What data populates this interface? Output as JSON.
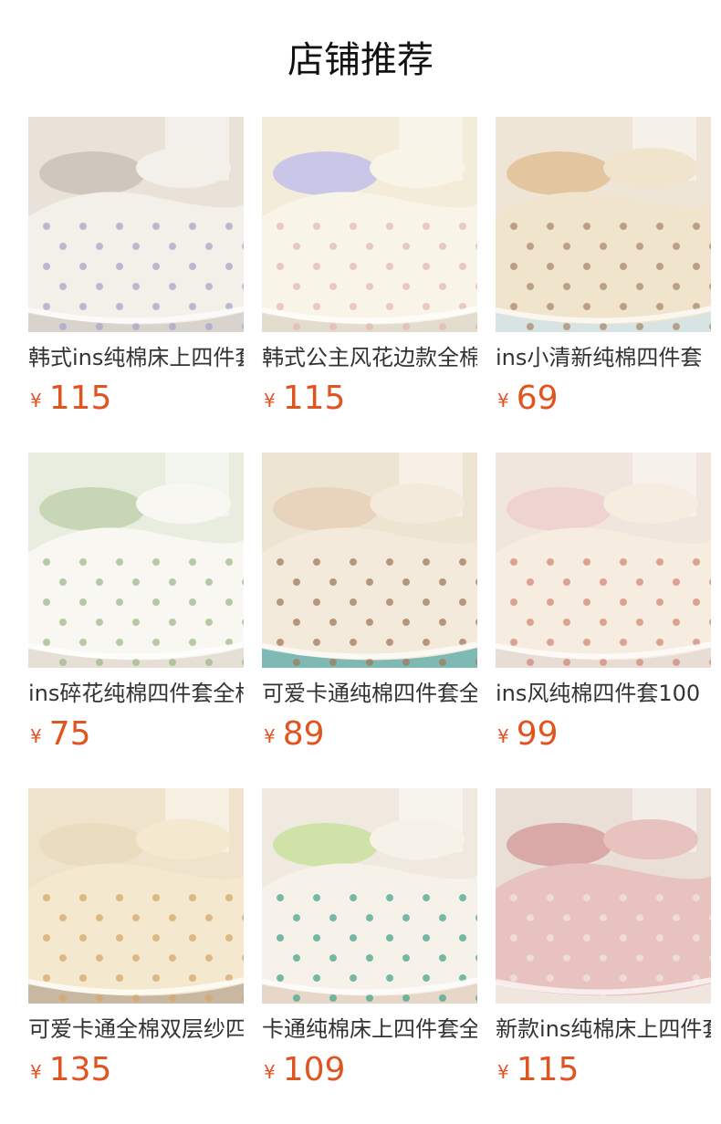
{
  "header": {
    "title": "店铺推荐"
  },
  "products": [
    {
      "name": "韩式ins纯棉床上四件套",
      "currency": "¥",
      "price": "115",
      "palette": {
        "bg": "#e9e2d9",
        "quilt": "#f3efe9",
        "pattern": "#a9a6c9",
        "accent": "#cfc7bd",
        "floor": "#d8d3cc"
      }
    },
    {
      "name": "韩式公主风花边款全棉四件套",
      "currency": "¥",
      "price": "115",
      "palette": {
        "bg": "#f2ecd9",
        "quilt": "#f8f5e8",
        "pattern": "#e4b8b0",
        "accent": "#c9c6e8",
        "floor": "#e3ddd0"
      }
    },
    {
      "name": "ins小清新纯棉四件套",
      "currency": "¥",
      "price": "69",
      "palette": {
        "bg": "#efe5d6",
        "quilt": "#f1e4cc",
        "pattern": "#a98a6e",
        "accent": "#e3c69f",
        "floor": "#d7e4e3"
      }
    },
    {
      "name": "ins碎花纯棉四件套全棉",
      "currency": "¥",
      "price": "75",
      "palette": {
        "bg": "#e8eddf",
        "quilt": "#f8f7f1",
        "pattern": "#9fb98a",
        "accent": "#c7d7b6",
        "floor": "#e6dfd6"
      }
    },
    {
      "name": "可爱卡通纯棉四件套全棉",
      "currency": "¥",
      "price": "89",
      "palette": {
        "bg": "#eee4d2",
        "quilt": "#f4eadb",
        "pattern": "#a27b5f",
        "accent": "#e8d3bd",
        "floor": "#7fb9b3"
      }
    },
    {
      "name": "ins风纯棉四件套100",
      "currency": "¥",
      "price": "99",
      "palette": {
        "bg": "#f1e6dd",
        "quilt": "#f6ecdf",
        "pattern": "#d28a78",
        "accent": "#efd3d0",
        "floor": "#e7ddd4"
      }
    },
    {
      "name": "可爱卡通全棉双层纱四件套",
      "currency": "¥",
      "price": "135",
      "palette": {
        "bg": "#efe3cc",
        "quilt": "#f4e9cf",
        "pattern": "#d6a76a",
        "accent": "#e9dcbf",
        "floor": "#c8b8a2"
      }
    },
    {
      "name": "卡通纯棉床上四件套全棉",
      "currency": "¥",
      "price": "109",
      "palette": {
        "bg": "#f0e9df",
        "quilt": "#f6f2ea",
        "pattern": "#4aa58c",
        "accent": "#cfe3a8",
        "floor": "#e7d7c9"
      }
    },
    {
      "name": "新款ins纯棉床上四件套",
      "currency": "¥",
      "price": "115",
      "palette": {
        "bg": "#eadfd6",
        "quilt": "#e7c2bf",
        "pattern": "#f2e3e2",
        "accent": "#d9a9a7",
        "floor": "#efe7df"
      }
    }
  ]
}
